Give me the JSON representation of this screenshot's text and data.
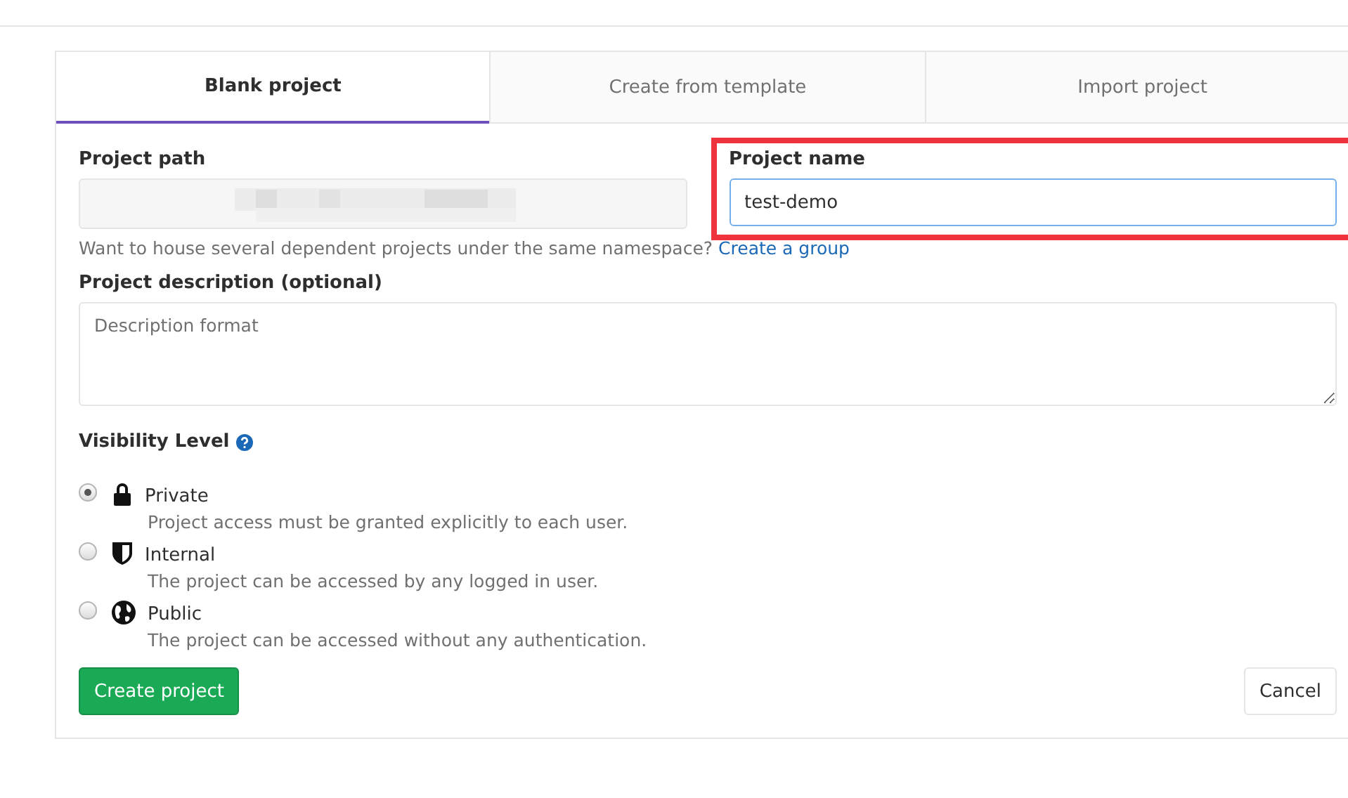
{
  "tabs": [
    {
      "label": "Blank project",
      "selected": true
    },
    {
      "label": "Create from template",
      "selected": false
    },
    {
      "label": "Import project",
      "selected": false
    }
  ],
  "path_field": {
    "label": "Project path",
    "redacted": true
  },
  "name_field": {
    "label": "Project name",
    "value": "test-demo",
    "highlighted": true
  },
  "hint": {
    "text": "Want to house several dependent projects under the same namespace?",
    "link": "Create a group"
  },
  "description": {
    "label": "Project description (optional)",
    "placeholder": "Description format"
  },
  "visibility": {
    "label": "Visibility Level",
    "options": [
      {
        "kind": "lock",
        "label": "Private",
        "description": "Project access must be granted explicitly to each user.",
        "selected": true
      },
      {
        "kind": "shield",
        "label": "Internal",
        "description": "The project can be accessed by any logged in user.",
        "selected": false
      },
      {
        "kind": "globe",
        "label": "Public",
        "description": "The project can be accessed without any authentication.",
        "selected": false
      }
    ]
  },
  "buttons": {
    "create": "Create project",
    "cancel": "Cancel"
  }
}
